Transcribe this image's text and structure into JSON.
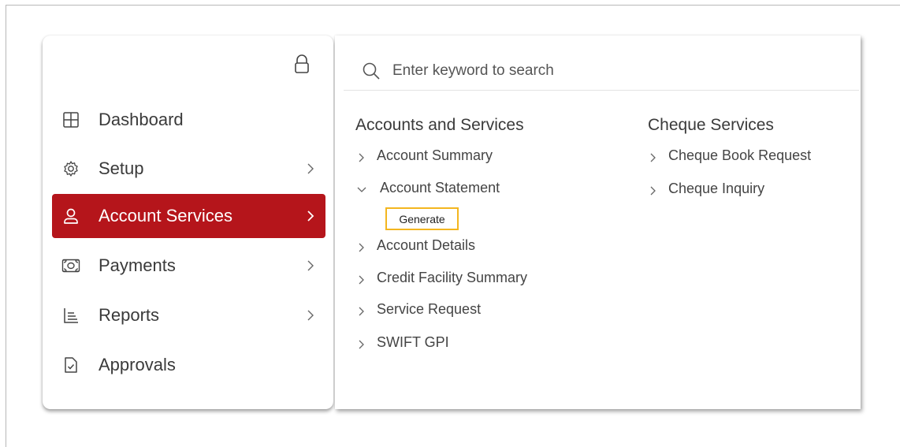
{
  "sidebar": {
    "items": [
      {
        "label": "Dashboard",
        "icon": "dashboard-grid-icon",
        "has_submenu": false,
        "active": false
      },
      {
        "label": "Setup",
        "icon": "gear-icon",
        "has_submenu": true,
        "active": false
      },
      {
        "label": "Account Services",
        "icon": "user-icon",
        "has_submenu": true,
        "active": true
      },
      {
        "label": "Payments",
        "icon": "banknote-icon",
        "has_submenu": true,
        "active": false
      },
      {
        "label": "Reports",
        "icon": "report-list-icon",
        "has_submenu": true,
        "active": false
      },
      {
        "label": "Approvals",
        "icon": "document-check-icon",
        "has_submenu": false,
        "active": false
      }
    ],
    "lock_icon": "lock-icon"
  },
  "search": {
    "placeholder": "Enter keyword to search",
    "value": ""
  },
  "menu": {
    "columns": [
      {
        "title": "Accounts and Services",
        "items": [
          {
            "label": "Account Summary",
            "expanded": false
          },
          {
            "label": "Account Statement",
            "expanded": true,
            "subitems": [
              "Generate"
            ]
          },
          {
            "label": "Account Details",
            "expanded": false
          },
          {
            "label": "Credit Facility Summary",
            "expanded": false
          },
          {
            "label": "Service Request",
            "expanded": false
          },
          {
            "label": "SWIFT GPI",
            "expanded": false
          }
        ]
      },
      {
        "title": "Cheque Services",
        "items": [
          {
            "label": "Cheque Book Request",
            "expanded": false
          },
          {
            "label": "Cheque Inquiry",
            "expanded": false
          }
        ]
      }
    ]
  },
  "colors": {
    "active_bg": "#b5151b",
    "highlight_border": "#f3b61f"
  }
}
